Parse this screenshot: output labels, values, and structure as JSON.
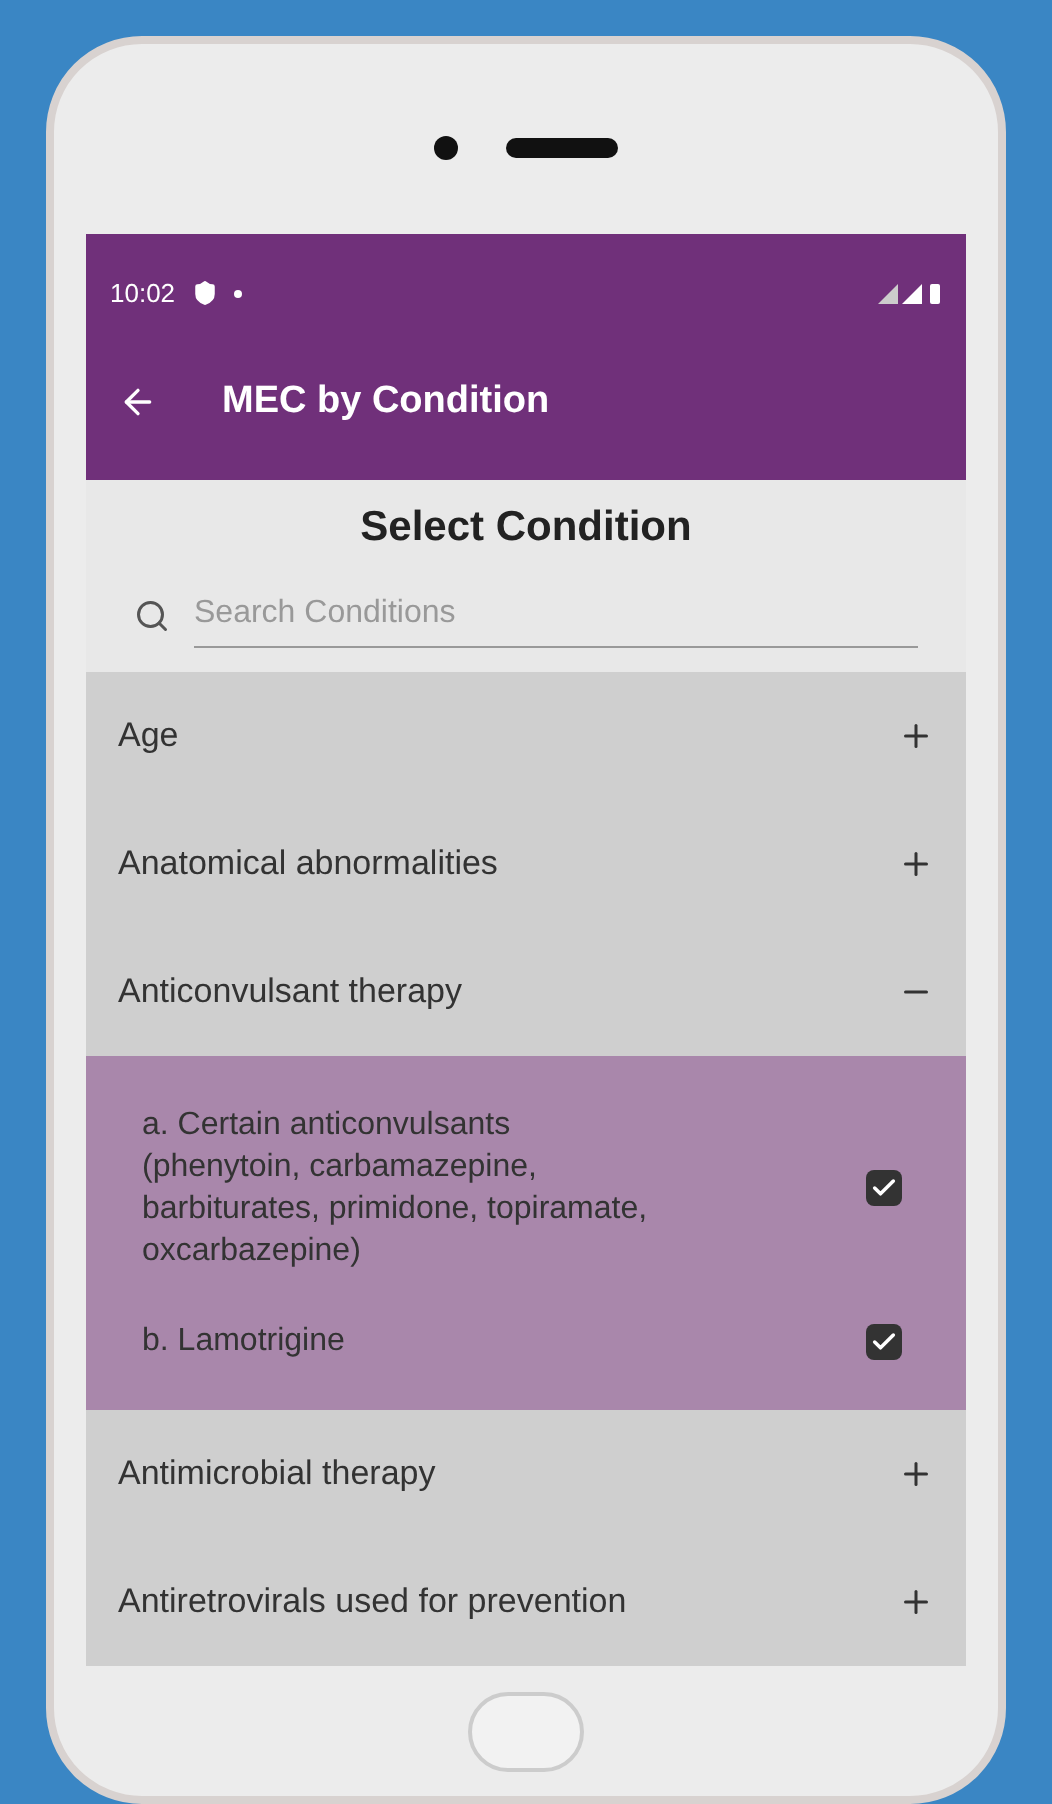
{
  "status_bar": {
    "time": "10:02"
  },
  "toolbar": {
    "title": "MEC by Condition"
  },
  "heading": "Select Condition",
  "search": {
    "placeholder": "Search Conditions"
  },
  "conditions": [
    {
      "label": "Age",
      "expanded": false
    },
    {
      "label": "Anatomical abnormalities",
      "expanded": false
    },
    {
      "label": "Anticonvulsant therapy",
      "expanded": true,
      "children": [
        {
          "label": "a. Certain anticonvulsants (phenytoin, carbamazepine, barbiturates, primidone, topiramate, oxcarbazepine)",
          "checked": true
        },
        {
          "label": "b. Lamotrigine",
          "checked": true
        }
      ]
    },
    {
      "label": "Antimicrobial therapy",
      "expanded": false
    },
    {
      "label": "Antiretrovirals used for prevention",
      "expanded": false
    }
  ]
}
